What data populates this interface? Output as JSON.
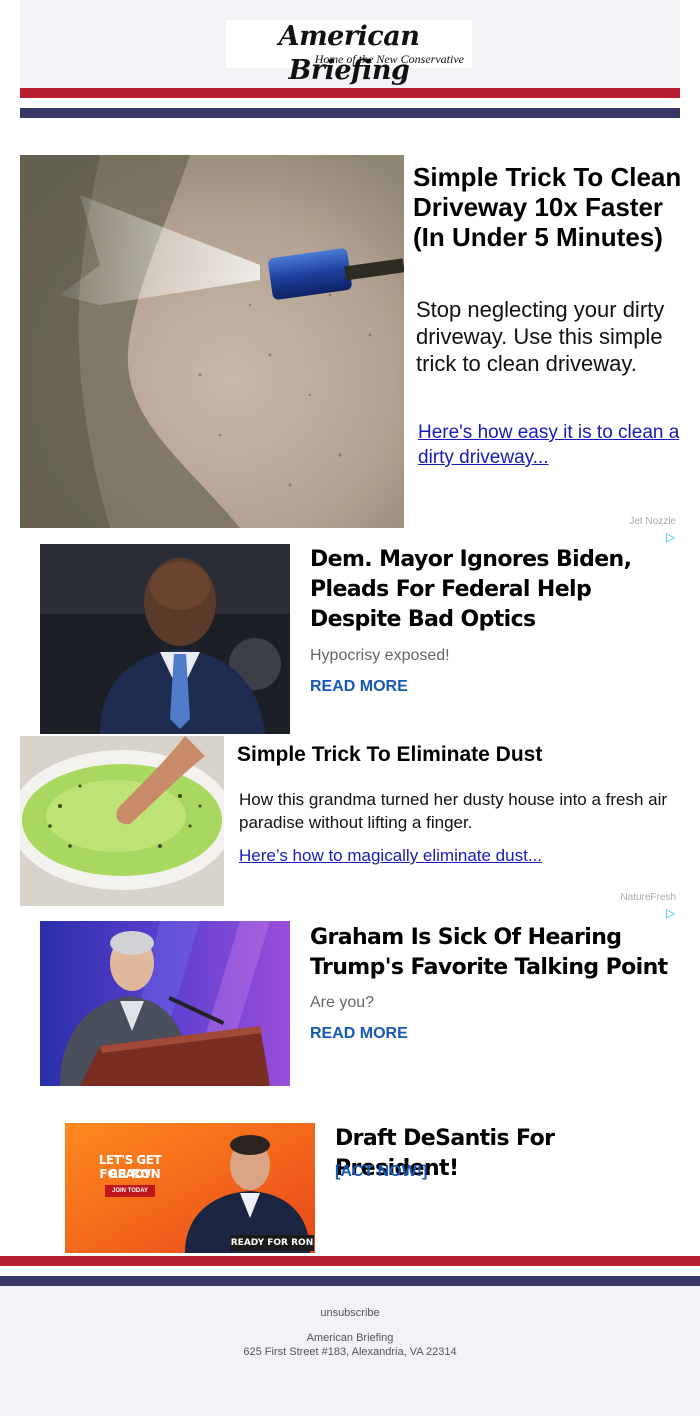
{
  "header": {
    "logo_title": "American Briefing",
    "logo_tagline": "Home of the New Conservative"
  },
  "colors": {
    "stripe_red": "#b71d33",
    "stripe_navy": "#383866",
    "link_blue": "#1a1ab8",
    "read_more_blue": "#1659b8"
  },
  "ad1": {
    "headline": "Simple Trick To Clean Driveway 10x Faster (In Under 5 Minutes)",
    "body": "Stop neglecting your dirty driveway. Use this simple trick to clean driveway.",
    "link": "Here's how easy it is to clean a dirty driveway...",
    "sponsor": "Jet Nozzle",
    "image": "pressure-washer-nozzle-photo"
  },
  "story1": {
    "headline": "Dem. Mayor Ignores Biden, Pleads For Federal Help Despite Bad Optics",
    "subtext": "Hypocrisy exposed!",
    "read_more": "READ MORE",
    "image": "man-in-suit-photo"
  },
  "ad2": {
    "headline": "Simple Trick To Eliminate Dust",
    "body": "How this grandma turned her dusty house into a fresh air paradise without lifting a finger.",
    "link": "Here’s how to magically eliminate dust...",
    "sponsor": "NatureFresh",
    "image": "green-liquid-bowl-photo"
  },
  "story2": {
    "headline": "Graham Is Sick Of Hearing Trump's Favorite Talking Point",
    "subtext": "Are you?",
    "read_more": "READ MORE",
    "image": "man-at-podium-photo"
  },
  "promo": {
    "headline": "Draft DeSantis For President!",
    "cta": "[ACT NOW!]",
    "banner_line1": "LET'S GET READY",
    "banner_line2": "FOR RON",
    "banner_button": "JOIN TODAY",
    "banner_tag": "READY FOR RON",
    "image": "campaign-banner-photo"
  },
  "footer": {
    "unsubscribe": "unsubscribe",
    "company": "American Briefing",
    "address": "625 First Street #183, Alexandria, VA 22314"
  },
  "icons": {
    "adchoices": "adchoices-icon"
  }
}
